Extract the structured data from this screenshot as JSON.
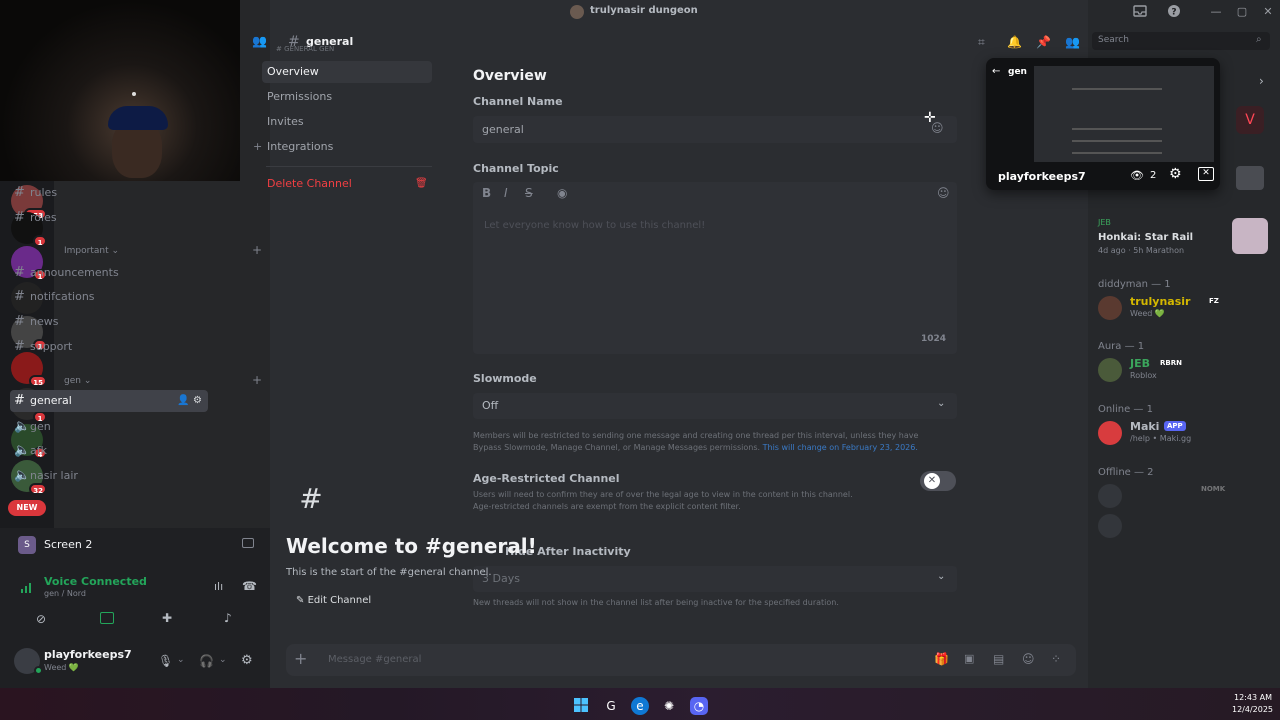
{
  "titlebar": {
    "title": "trulynasir dungeon",
    "buttons": [
      "inbox-icon",
      "help-icon",
      "minimize-icon",
      "maximize-icon",
      "close-icon"
    ]
  },
  "servers": [
    {
      "badge": "153",
      "color": "#7a3a3a"
    },
    {
      "badge": "1",
      "color": "#111"
    },
    {
      "badge": "1",
      "color": "#6a2a8a"
    },
    {
      "badge": "",
      "color": "#222"
    },
    {
      "badge": "1",
      "color": "#444"
    },
    {
      "badge": "15",
      "color": "#8a1a1a"
    },
    {
      "badge": "1",
      "color": "#2a2a2a"
    },
    {
      "badge": "4",
      "color": "#2a4a2a"
    },
    {
      "badge": "32",
      "color": "#3a5a3a"
    }
  ],
  "server_rail": {
    "new_label": "NEW"
  },
  "channels": {
    "top": [
      {
        "name": "rules"
      },
      {
        "name": "roles"
      }
    ],
    "important_label": "Important",
    "important": [
      {
        "name": "announcements"
      },
      {
        "name": "notifcations"
      },
      {
        "name": "news"
      },
      {
        "name": "support"
      }
    ],
    "gen_label": "gen",
    "gen": [
      {
        "name": "general",
        "type": "text"
      },
      {
        "name": "gen",
        "type": "voice"
      },
      {
        "name": "afk",
        "type": "voice"
      },
      {
        "name": "nasir lair",
        "type": "voice"
      }
    ]
  },
  "screen_share": {
    "label": "Screen 2"
  },
  "voice": {
    "status": "Voice Connected",
    "channel": "gen / Nord"
  },
  "user_panel": {
    "username": "playforkeeps7",
    "status": "Weed 💚"
  },
  "header": {
    "channel_name": "general",
    "overlay_label": "# GENERAL GEN",
    "search_placeholder": "Search"
  },
  "settings_nav": {
    "items": [
      "Overview",
      "Permissions",
      "Invites",
      "Integrations"
    ],
    "delete": "Delete Channel"
  },
  "overview": {
    "heading": "Overview",
    "channel_name_label": "Channel Name",
    "channel_name_value": "general",
    "topic_label": "Channel Topic",
    "topic_placeholder": "Let everyone know how to use this channel!",
    "topic_count": "1024",
    "slowmode_label": "Slowmode",
    "slowmode_value": "Off",
    "slowmode_help": "Members will be restricted to sending one message and creating one thread per this interval, unless they have Bypass Slowmode, Manage Channel, or Manage Messages permissions.",
    "slowmode_link": "This will change on February 23, 2026.",
    "age_label": "Age-Restricted Channel",
    "age_help1": "Users will need to confirm they are of over the legal age to view in the content in this channel.",
    "age_help2": "Age-restricted channels are exempt from the explicit content filter.",
    "inactivity_label": "Hide After Inactivity",
    "inactivity_value": "3 Days",
    "inactivity_help": "New threads will not show in the channel list after being inactive for the specified duration."
  },
  "welcome": {
    "title": "Welcome to #general!",
    "subtitle": "This is the start of the #general channel.",
    "edit": "Edit Channel"
  },
  "composer": {
    "placeholder": "Message #general"
  },
  "popup": {
    "back_label": "gen",
    "user": "playforkeeps7",
    "viewers": "2"
  },
  "members": {
    "activity_title": "Honkai: Star Rail",
    "activity_sub": "4d ago · 5h Marathon",
    "activity_header": "JEB",
    "groups": [
      {
        "label": "diddyman — 1",
        "members": [
          {
            "name": "trulynasir",
            "tag": "FZ",
            "sub": "Weed 💚",
            "color": "#d4b800"
          }
        ]
      },
      {
        "label": "Aura — 1",
        "members": [
          {
            "name": "JEB",
            "tag": "RBRN",
            "sub": "Roblox",
            "color": "#3ba55c"
          }
        ]
      },
      {
        "label": "Online — 1",
        "members": [
          {
            "name": "Maki",
            "tag": "APP",
            "sub": "/help • Maki.gg",
            "color": "#b5bac1"
          }
        ]
      },
      {
        "label": "Offline — 2",
        "members": [
          {
            "name": "",
            "tag": "NOMK",
            "sub": "",
            "color": "#4e5058"
          },
          {
            "name": "",
            "tag": "",
            "sub": "",
            "color": "#4e5058"
          }
        ]
      }
    ]
  },
  "clock": {
    "time": "12:43 AM",
    "date": "12/4/2025"
  },
  "colors": {
    "accent": "#5865f2",
    "danger": "#f23f43",
    "green": "#23a55a"
  }
}
